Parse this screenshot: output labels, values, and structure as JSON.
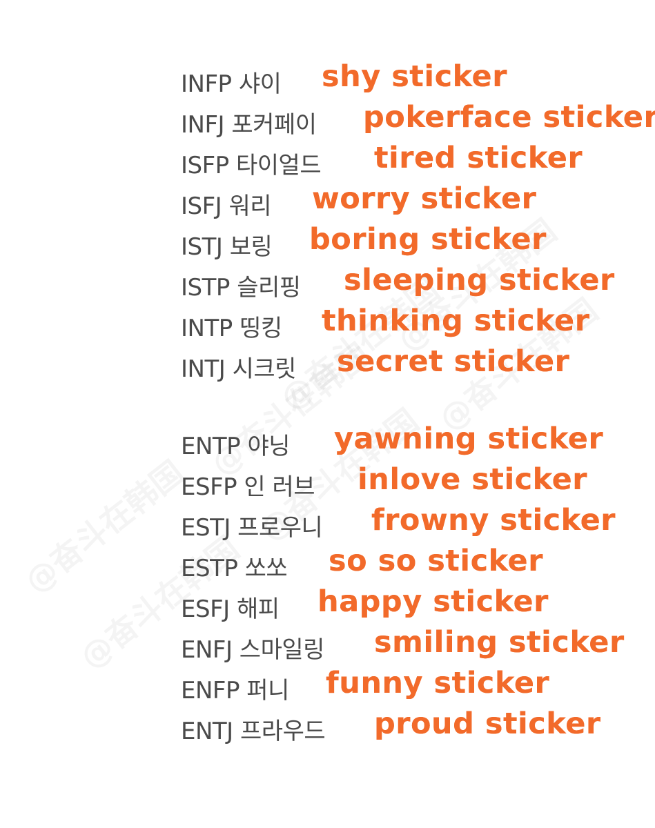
{
  "watermark": "@奋斗在韩国",
  "introverts": [
    {
      "type_label": "INFP 샤이",
      "translation": "shy sticker"
    },
    {
      "type_label": "INFJ 포커페이",
      "translation": "pokerface sticker"
    },
    {
      "type_label": "ISFP 타이얼드",
      "translation": "tired sticker"
    },
    {
      "type_label": "ISFJ 워리",
      "translation": "worry sticker"
    },
    {
      "type_label": "ISTJ 보링",
      "translation": "boring sticker"
    },
    {
      "type_label": "ISTP 슬리핑",
      "translation": "sleeping sticker"
    },
    {
      "type_label": "INTP 띵킹",
      "translation": "thinking sticker"
    },
    {
      "type_label": "INTJ 시크릿",
      "translation": "secret sticker"
    }
  ],
  "extroverts": [
    {
      "type_label": "ENTP 야닝",
      "translation": "yawning sticker"
    },
    {
      "type_label": "ESFP 인 러브",
      "translation": "inlove sticker"
    },
    {
      "type_label": "ESTJ 프로우니",
      "translation": "frowny sticker"
    },
    {
      "type_label": "ESTP 쏘쏘",
      "translation": "so so sticker"
    },
    {
      "type_label": "ESFJ 해피",
      "translation": "happy sticker"
    },
    {
      "type_label": "ENFJ 스마일링",
      "translation": "smiling sticker"
    },
    {
      "type_label": "ENFP 퍼니",
      "translation": "funny sticker"
    },
    {
      "type_label": "ENTJ 프라우드",
      "translation": "proud sticker"
    }
  ]
}
